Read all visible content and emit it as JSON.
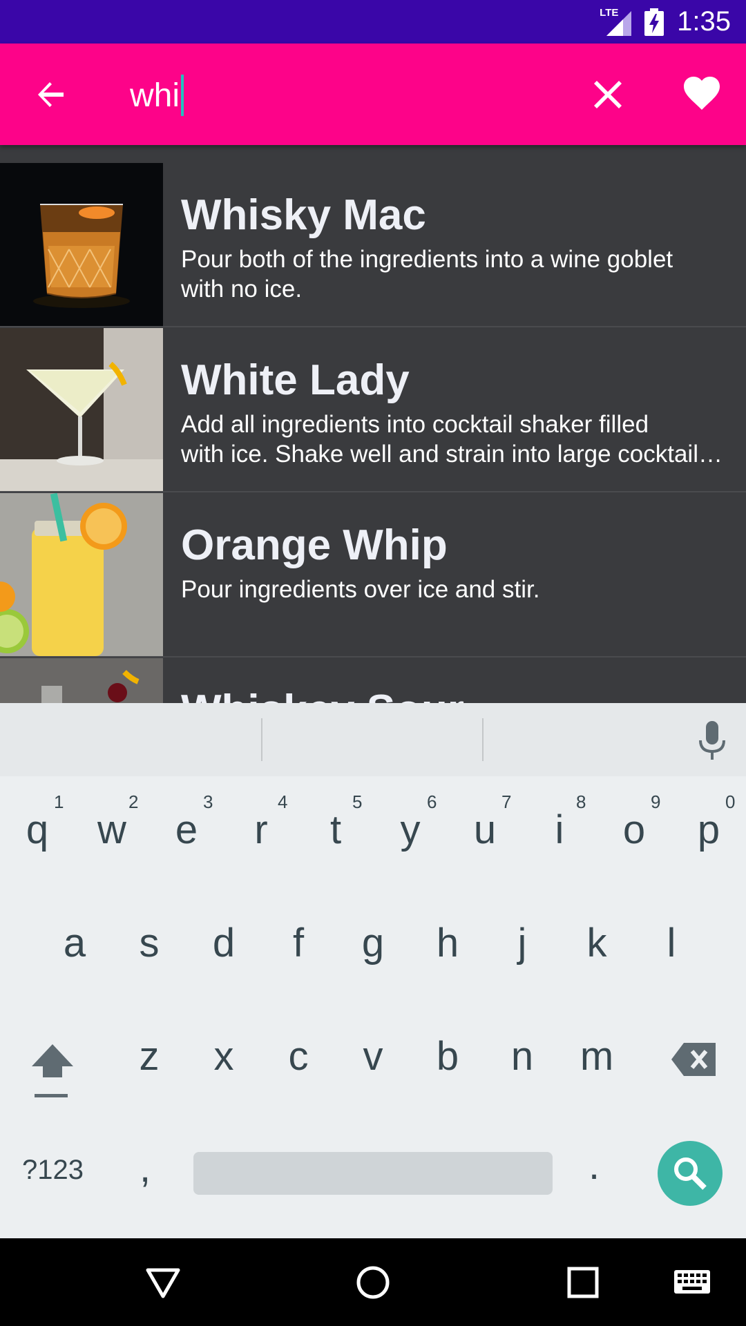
{
  "status_bar": {
    "network_label": "LTE",
    "time": "1:35",
    "icons": [
      "lte-signal-icon",
      "battery-charging-icon"
    ]
  },
  "app_bar": {
    "background_color": "#fd0389",
    "search_value": "whi",
    "icons": [
      "back-arrow-icon",
      "close-icon",
      "heart-icon"
    ]
  },
  "results": [
    {
      "title": "Whisky Mac",
      "description": "Pour both of the ingredients into a wine goblet\nwith no ice."
    },
    {
      "title": "White Lady",
      "description": "Add all ingredients into cocktail shaker filled\nwith ice. Shake well and strain into large cocktail…"
    },
    {
      "title": "Orange Whip",
      "description": "Pour ingredients over ice and stir."
    },
    {
      "title": "Whiskey Sour",
      "description": ""
    }
  ],
  "keyboard": {
    "row1": [
      "q",
      "w",
      "e",
      "r",
      "t",
      "y",
      "u",
      "i",
      "o",
      "p"
    ],
    "row1_hints": [
      "1",
      "2",
      "3",
      "4",
      "5",
      "6",
      "7",
      "8",
      "9",
      "0"
    ],
    "row2": [
      "a",
      "s",
      "d",
      "f",
      "g",
      "h",
      "j",
      "k",
      "l"
    ],
    "row3": [
      "z",
      "x",
      "c",
      "v",
      "b",
      "n",
      "m"
    ],
    "symbols_label": "?123",
    "comma": ",",
    "period": ".",
    "action_icon": "search-icon",
    "action_color": "#3eb6a6"
  },
  "nav_bar": {
    "icons": [
      "back-triangle-icon",
      "home-circle-icon",
      "recents-square-icon",
      "keyboard-icon"
    ]
  }
}
